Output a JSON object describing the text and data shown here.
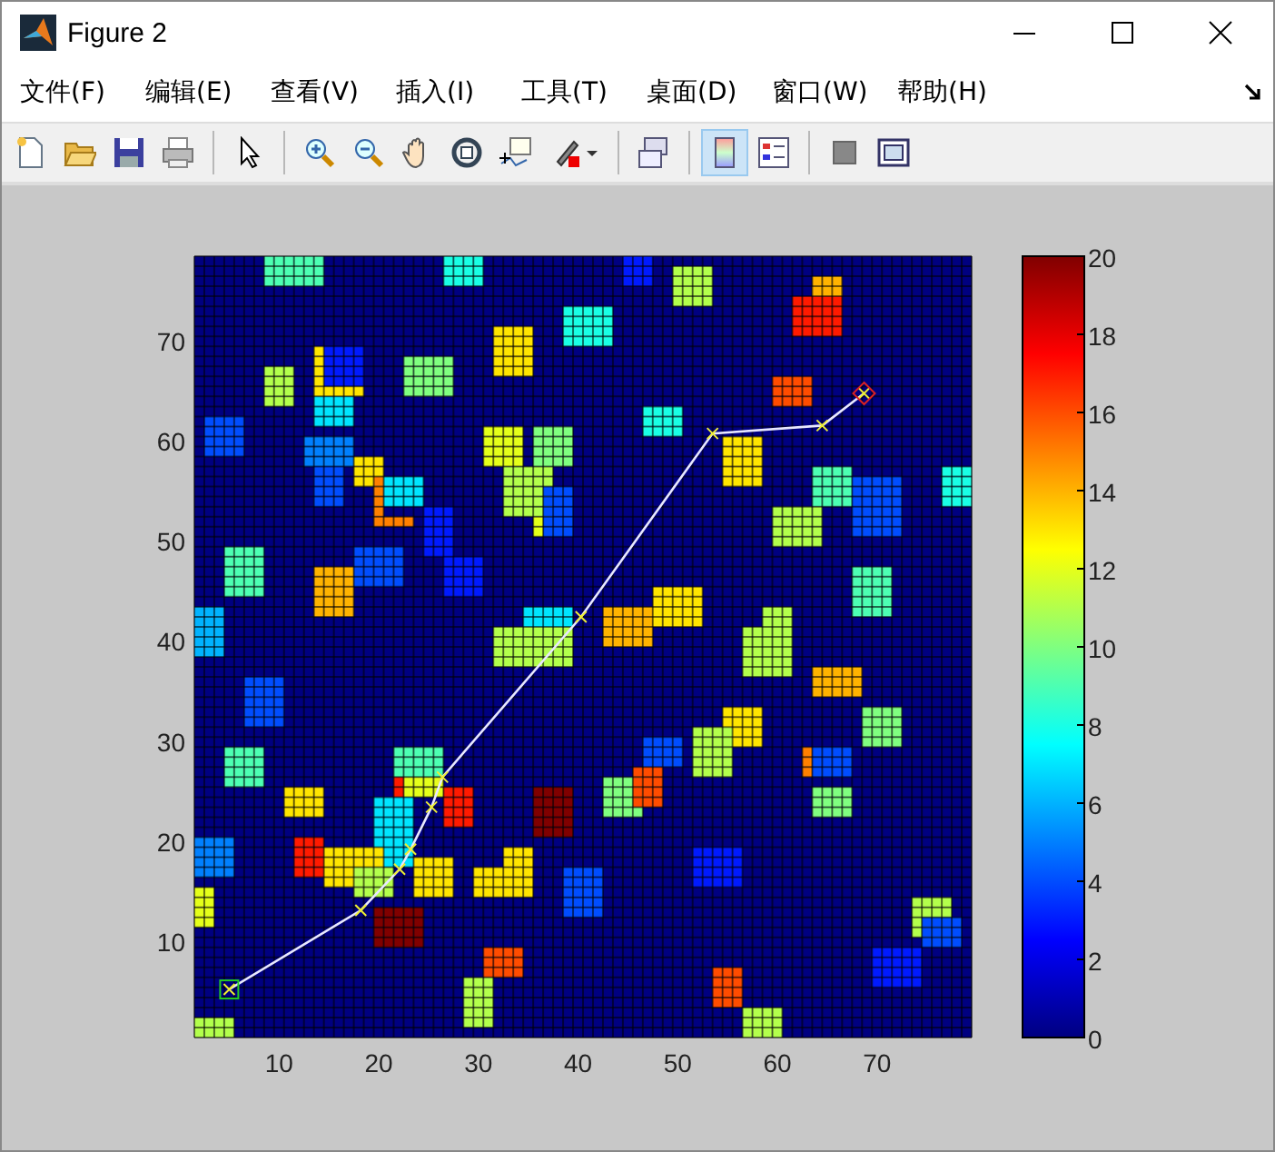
{
  "window": {
    "title": "Figure 2"
  },
  "menu": [
    "文件(F)",
    "编辑(E)",
    "查看(V)",
    "插入(I)",
    "工具(T)",
    "桌面(D)",
    "窗口(W)",
    "帮助(H)"
  ],
  "toolbar": {
    "colorbar_button": {
      "selected": true
    }
  },
  "axes": {
    "x_ticks": [
      "10",
      "20",
      "30",
      "40",
      "50",
      "60",
      "70"
    ],
    "y_ticks": [
      "70",
      "60",
      "50",
      "40",
      "30",
      "20",
      "10"
    ]
  },
  "colorbar": {
    "ticks": [
      "20",
      "18",
      "16",
      "14",
      "12",
      "10",
      "8",
      "6",
      "4",
      "2",
      "0"
    ]
  }
}
